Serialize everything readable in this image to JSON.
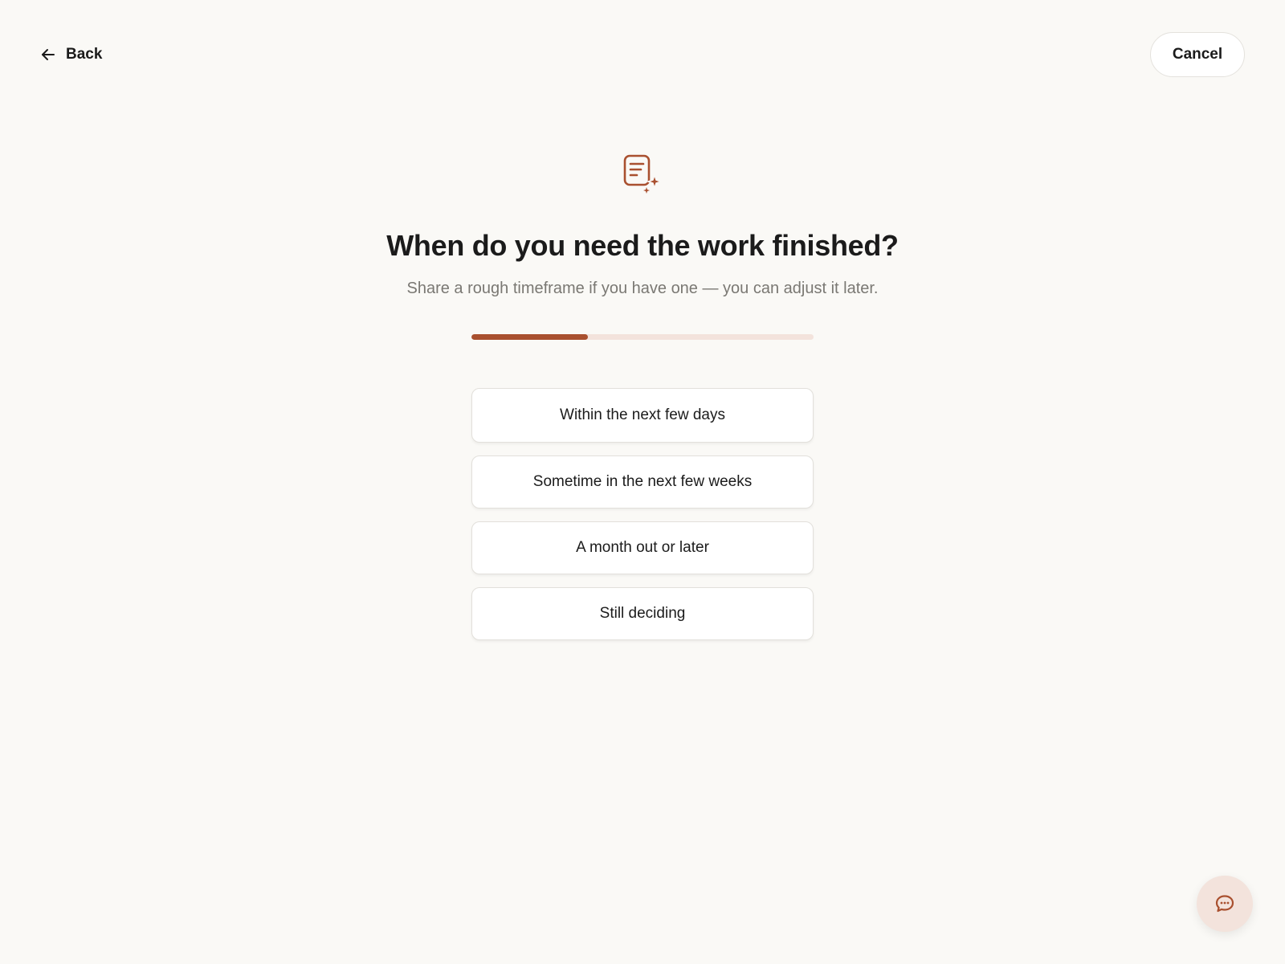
{
  "header": {
    "back_label": "Back",
    "back_icon": "arrow-left-icon",
    "cancel_label": "Cancel"
  },
  "hero": {
    "icon": "document-sparkle-icon",
    "title": "When do you need the work finished?",
    "subtitle": "Share a rough timeframe if you have one — you can adjust it later."
  },
  "progress": {
    "fraction": 0.34
  },
  "options": [
    {
      "label": "Within the next few days"
    },
    {
      "label": "Sometime in the next few weeks"
    },
    {
      "label": "A month out or later"
    },
    {
      "label": "Still deciding"
    }
  ],
  "chat": {
    "icon": "chat-bubble-icon"
  },
  "colors": {
    "accent": "#a9502f",
    "track": "#f3e3dc",
    "background": "#faf9f6"
  }
}
